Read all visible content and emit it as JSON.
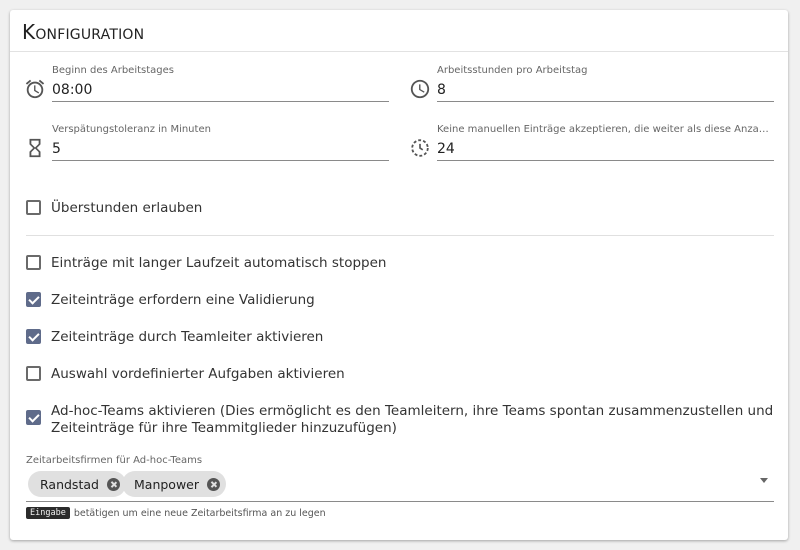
{
  "header": {
    "title": "Konfiguration"
  },
  "fields": {
    "work_start": {
      "label": "Beginn des Arbeitstages",
      "value": "08:00",
      "icon": "alarm-clock-icon"
    },
    "work_hours": {
      "label": "Arbeitsstunden pro Arbeitstag",
      "value": "8",
      "icon": "clock-icon"
    },
    "delay_tolerance": {
      "label": "Verspätungstoleranz in Minuten",
      "value": "5",
      "icon": "hourglass-icon"
    },
    "manual_entries_hours": {
      "label": "Keine manuellen Einträge akzeptieren, die weiter als diese Anzahl an Stu...",
      "value": "24",
      "icon": "history-clock-icon"
    }
  },
  "checkboxes": {
    "overtime": {
      "label": "Überstunden erlauben",
      "checked": false
    },
    "auto_stop": {
      "label": "Einträge mit langer Laufzeit automatisch stoppen",
      "checked": false
    },
    "validation": {
      "label": "Zeiteinträge erfordern eine Validierung",
      "checked": true
    },
    "teamlead_activation": {
      "label": "Zeiteinträge durch Teamleiter aktivieren",
      "checked": true
    },
    "predefined_tasks": {
      "label": "Auswahl vordefinierter Aufgaben aktivieren",
      "checked": false
    },
    "adhoc_teams": {
      "label": "Ad-hoc-Teams aktivieren (Dies ermöglicht es den Teamleitern, ihre Teams spontan zusammenzustellen und Zeiteinträge für ihre Teammitglieder hinzuzufügen)",
      "checked": true
    }
  },
  "temp_agencies": {
    "label": "Zeitarbeitsfirmen für Ad-hoc-Teams",
    "chips": [
      "Randstad",
      "Manpower"
    ],
    "hint_key": "Eingabe",
    "hint_text": "betätigen um eine neue Zeitarbeitsfirma an zu legen"
  },
  "colors": {
    "checkbox_checked": "#5f6b8a",
    "chip_bg": "#e0e0e0"
  }
}
